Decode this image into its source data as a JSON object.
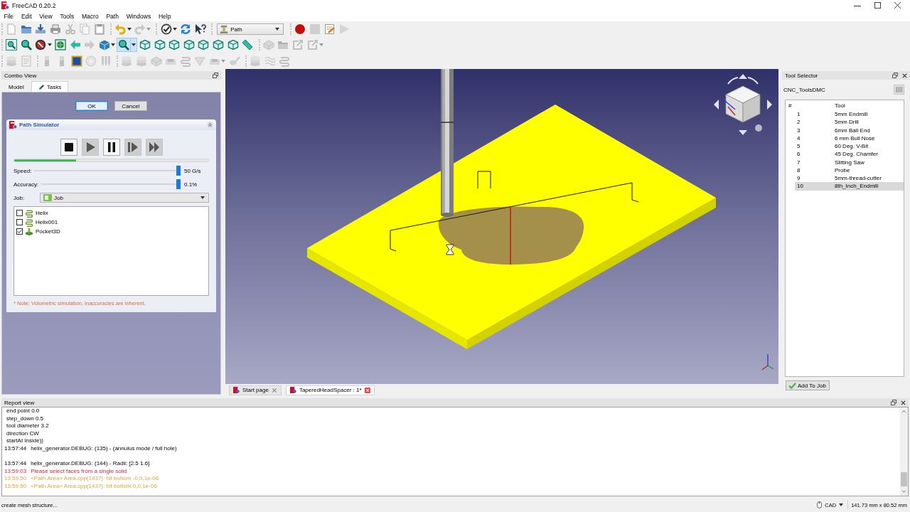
{
  "window": {
    "title": "FreeCAD 0.20.2"
  },
  "menu": [
    "File",
    "Edit",
    "View",
    "Tools",
    "Macro",
    "Path",
    "Windows",
    "Help"
  ],
  "toolbars": [
    {
      "groups": [
        {
          "items": [
            {
              "kind": "new-doc",
              "disabled": false,
              "highlighted": false
            },
            {
              "kind": "open",
              "disabled": false,
              "highlighted": false
            },
            {
              "kind": "save",
              "disabled": false,
              "highlighted": false
            },
            {
              "kind": "print",
              "disabled": false,
              "highlighted": false
            },
            {
              "kind": "cut",
              "disabled": true,
              "highlighted": false
            },
            {
              "kind": "copy",
              "disabled": true,
              "highlighted": false
            },
            {
              "kind": "paste",
              "disabled": false,
              "highlighted": false
            }
          ]
        },
        {
          "items": [
            {
              "kind": "undo",
              "disabled": false,
              "highlighted": false
            },
            {
              "kind": "caret",
              "disabled": false,
              "highlighted": false
            },
            {
              "kind": "redo",
              "disabled": true,
              "highlighted": false
            },
            {
              "kind": "caret",
              "disabled": true,
              "highlighted": false
            }
          ]
        },
        {
          "items": [
            {
              "kind": "workbench",
              "disabled": false,
              "highlighted": false
            },
            {
              "kind": "caret",
              "disabled": false,
              "highlighted": false
            },
            {
              "kind": "refresh",
              "disabled": false,
              "highlighted": false
            },
            {
              "kind": "whats-this",
              "disabled": false,
              "highlighted": false
            }
          ]
        },
        {
          "items": [
            {
              "kind": "workbench-combo",
              "value": "Path",
              "disabled": false,
              "highlighted": false
            }
          ]
        },
        {
          "items": [
            {
              "kind": "record",
              "disabled": false,
              "highlighted": false
            },
            {
              "kind": "stop",
              "disabled": true,
              "highlighted": false
            },
            {
              "kind": "macro",
              "disabled": false,
              "highlighted": false
            },
            {
              "kind": "run",
              "disabled": true,
              "highlighted": false
            }
          ]
        }
      ]
    },
    {
      "groups": [
        {
          "items": [
            {
              "kind": "fit-all",
              "disabled": false,
              "highlighted": false
            },
            {
              "kind": "fit-sel",
              "disabled": false,
              "highlighted": false
            },
            {
              "kind": "draw-style",
              "disabled": false,
              "highlighted": false
            },
            {
              "kind": "caret",
              "disabled": false,
              "highlighted": false
            },
            {
              "kind": "bbox",
              "disabled": false,
              "highlighted": false
            },
            {
              "kind": "back",
              "disabled": false,
              "highlighted": false
            },
            {
              "kind": "fwd",
              "disabled": true,
              "highlighted": false
            },
            {
              "kind": "std-views",
              "disabled": false,
              "highlighted": false
            },
            {
              "kind": "caret",
              "disabled": false,
              "highlighted": false
            },
            {
              "kind": "zoom",
              "disabled": false,
              "highlighted": true
            },
            {
              "kind": "caret",
              "disabled": false,
              "highlighted": true
            },
            {
              "kind": "cube",
              "disabled": false,
              "highlighted": false
            },
            {
              "kind": "cube",
              "disabled": false,
              "highlighted": false
            },
            {
              "kind": "cube",
              "disabled": false,
              "highlighted": false
            },
            {
              "kind": "cube",
              "disabled": false,
              "highlighted": false
            },
            {
              "kind": "cube",
              "disabled": false,
              "highlighted": false
            },
            {
              "kind": "cube",
              "disabled": false,
              "highlighted": false
            },
            {
              "kind": "cube",
              "disabled": false,
              "highlighted": false
            },
            {
              "kind": "measure",
              "disabled": false,
              "highlighted": false
            }
          ]
        },
        {
          "items": [
            {
              "kind": "job",
              "disabled": true,
              "highlighted": false
            },
            {
              "kind": "open",
              "disabled": true,
              "highlighted": false
            },
            {
              "kind": "export",
              "disabled": true,
              "highlighted": false
            },
            {
              "kind": "export",
              "disabled": true,
              "highlighted": false
            },
            {
              "kind": "caret",
              "disabled": true,
              "highlighted": false
            }
          ]
        }
      ]
    },
    {
      "groups": [
        {
          "items": [
            {
              "kind": "stack",
              "disabled": true,
              "highlighted": false
            },
            {
              "kind": "inspect",
              "disabled": true,
              "highlighted": false
            }
          ]
        },
        {
          "items": [
            {
              "kind": "end-mill",
              "disabled": true,
              "highlighted": false
            },
            {
              "kind": "end-mill",
              "disabled": true,
              "highlighted": false
            },
            {
              "kind": "tile",
              "disabled": false,
              "highlighted": false
            },
            {
              "kind": "circle",
              "disabled": true,
              "highlighted": false
            },
            {
              "kind": "drill",
              "disabled": true,
              "highlighted": false
            }
          ]
        },
        {
          "items": [
            {
              "kind": "stack",
              "disabled": true,
              "highlighted": false
            },
            {
              "kind": "stack",
              "disabled": true,
              "highlighted": false
            },
            {
              "kind": "job",
              "disabled": true,
              "highlighted": false
            },
            {
              "kind": "pocket",
              "disabled": true,
              "highlighted": false
            },
            {
              "kind": "helix",
              "disabled": true,
              "highlighted": false
            },
            {
              "kind": "v-carve",
              "disabled": true,
              "highlighted": false
            },
            {
              "kind": "pocket",
              "disabled": true,
              "highlighted": false
            },
            {
              "kind": "caret",
              "disabled": true,
              "highlighted": false
            },
            {
              "kind": "bowl",
              "disabled": true,
              "highlighted": false
            }
          ]
        },
        {
          "items": [
            {
              "kind": "stack",
              "disabled": true,
              "highlighted": false
            },
            {
              "kind": "wave",
              "disabled": true,
              "highlighted": false
            },
            {
              "kind": "helix",
              "disabled": true,
              "highlighted": false
            }
          ]
        }
      ]
    }
  ],
  "combo_view": {
    "title": "Combo View",
    "tabs": [
      {
        "label": "Model",
        "kind": "model",
        "selected": false
      },
      {
        "label": "Tasks",
        "kind": "tasks",
        "selected": true
      }
    ],
    "buttons": [
      {
        "label": "OK",
        "default": true
      },
      {
        "label": "Cancel",
        "default": false
      }
    ],
    "path_simulator": {
      "title": "Path Simulator",
      "controls": [
        {
          "kind": "stop",
          "disabled": false
        },
        {
          "kind": "play",
          "disabled": true
        },
        {
          "kind": "pause",
          "disabled": false
        },
        {
          "kind": "step",
          "disabled": true
        },
        {
          "kind": "fast-forward",
          "disabled": true
        }
      ],
      "progress": {
        "level": 0.32
      },
      "speed": {
        "label": "Speed:",
        "level": 1,
        "reading": "50 G/s"
      },
      "accuracy": {
        "label": "Accuracy:",
        "level": 1,
        "reading": "0.1%"
      },
      "job": {
        "label": "Job:",
        "value": "Job"
      },
      "operations": [
        {
          "name": "Helix",
          "kind": "helix",
          "checked": false
        },
        {
          "name": "Helix001",
          "kind": "helix",
          "checked": false
        },
        {
          "name": "Pocket3D",
          "kind": "pocket",
          "checked": true
        }
      ],
      "note": "* Note: Volumetric simulation, inaccuracies are inherent."
    }
  },
  "viewport": {
    "tabs": [
      {
        "label": "Start page",
        "selected": false
      },
      {
        "label": "TaperedHeadSpacer : 1*",
        "selected": true
      }
    ]
  },
  "tool_selector": {
    "title": "Tool Selector",
    "library": "CNC_ToolsDMC",
    "columns": [
      "#",
      "Tool"
    ],
    "tools": [
      {
        "number": "1",
        "name": "5mm Endmill",
        "selected": false
      },
      {
        "number": "2",
        "name": "5mm Drill",
        "selected": false
      },
      {
        "number": "3",
        "name": "6mm Ball End",
        "selected": false
      },
      {
        "number": "4",
        "name": "6 mm Bull Nose",
        "selected": false
      },
      {
        "number": "5",
        "name": "60 Deg. V-Bit",
        "selected": false
      },
      {
        "number": "6",
        "name": "45 Deg. Chamfer",
        "selected": false
      },
      {
        "number": "7",
        "name": "Slitting Saw",
        "selected": false
      },
      {
        "number": "8",
        "name": "Probe",
        "selected": false
      },
      {
        "number": "9",
        "name": "5mm-thread-cutter",
        "selected": false
      },
      {
        "number": "10",
        "name": "8th_Inch_Endmill",
        "selected": true
      }
    ],
    "add_button": "Add To Job"
  },
  "report_view": {
    "title": "Report view",
    "lines": [
      {
        "kind": "log",
        "text": "end point 0.0"
      },
      {
        "kind": "log",
        "text": "step_down 0.5"
      },
      {
        "kind": "log",
        "text": "tool diameter 3.2"
      },
      {
        "kind": "log",
        "text": "direction CW"
      },
      {
        "kind": "log",
        "text": "startAt Inside))"
      },
      {
        "kind": "log",
        "time": "13:57:44",
        "text": "helix_generator.DEBUG: (135) - (annulus mode / full hole)"
      },
      {
        "kind": "blank"
      },
      {
        "kind": "log",
        "time": "13:57:44",
        "text": "helix_generator.DEBUG: (144) - Radii: [2.5 1.6]"
      },
      {
        "kind": "error",
        "time": "13:59:03",
        "text": "Please select faces from a single solid"
      },
      {
        "kind": "warning",
        "time": "13:59:50",
        "text": "<Path.Area> Area.cpp(1437): hit bottom -0,0,1e-06"
      },
      {
        "kind": "warning",
        "time": "13:59:50",
        "text": "<Path.Area> Area.cpp(1437): hit bottom 0,0,1e-06"
      }
    ]
  },
  "status_bar": {
    "message": "create mesh structure...",
    "navigation": "CAD",
    "dimensions": "141.73 mm x 80.52 mm"
  }
}
